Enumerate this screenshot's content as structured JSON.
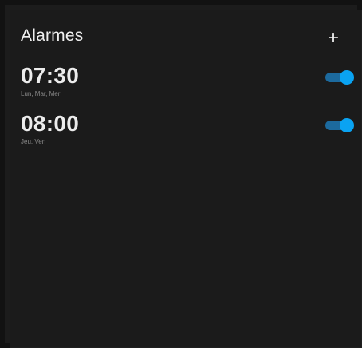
{
  "header": {
    "title": "Alarmes",
    "add_icon": "+"
  },
  "alarms": [
    {
      "time": "07:30",
      "days": "Lun, Mar, Mer",
      "enabled": true
    },
    {
      "time": "08:00",
      "days": "Jeu, Ven",
      "enabled": true
    }
  ],
  "colors": {
    "background": "#1b1b1b",
    "accent": "#0aa3f2",
    "toggle_track": "#1c6a9e",
    "text_primary": "#ececec",
    "text_secondary": "#8a8a8a"
  }
}
